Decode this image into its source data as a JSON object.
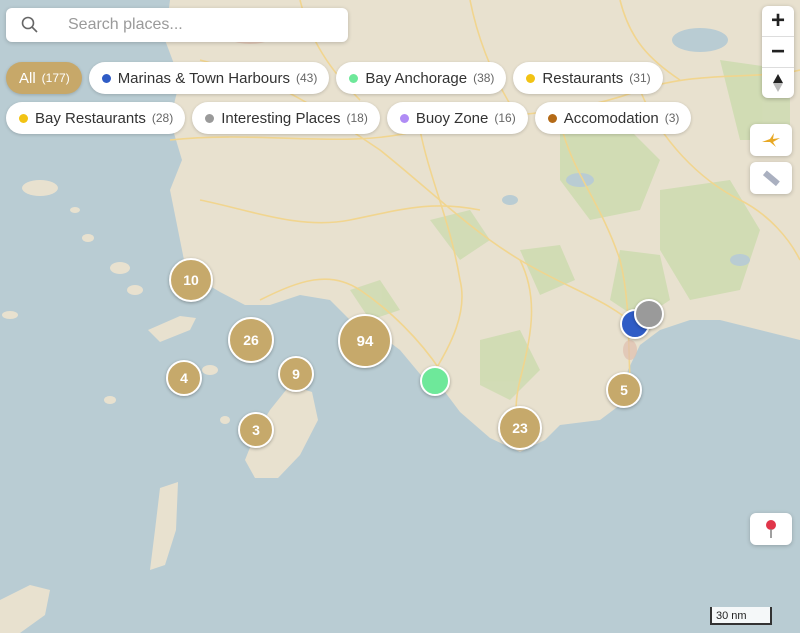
{
  "search": {
    "placeholder": "Search places..."
  },
  "filters": [
    {
      "label": "All",
      "count": "(177)",
      "color": "",
      "active": true
    },
    {
      "label": "Marinas & Town Harbours",
      "count": "(43)",
      "color": "#2f5cc6"
    },
    {
      "label": "Bay Anchorage",
      "count": "(38)",
      "color": "#6ee89a"
    },
    {
      "label": "Restaurants",
      "count": "(31)",
      "color": "#f2c314"
    },
    {
      "label": "Bay Restaurants",
      "count": "(28)",
      "color": "#f2c314"
    },
    {
      "label": "Interesting Places",
      "count": "(18)",
      "color": "#9a9a9a"
    },
    {
      "label": "Buoy Zone",
      "count": "(16)",
      "color": "#b08cf5"
    },
    {
      "label": "Accomodation",
      "count": "(3)",
      "color": "#b46a17"
    }
  ],
  "zoom": {
    "in": "+",
    "out": "−",
    "compass": "north-arrow-icon"
  },
  "clusters": [
    "10",
    "26",
    "94",
    "4",
    "9",
    "3",
    "23",
    "5"
  ],
  "markers": [
    {
      "type": "bay-anchorage",
      "color": "#6ee89a"
    },
    {
      "type": "marina",
      "color": "#2f5cc6"
    },
    {
      "type": "interesting-place",
      "color": "#9a9a9a"
    }
  ],
  "scale": {
    "label": "30 nm"
  },
  "colors": {
    "cluster": "#c6a96b",
    "water": "#b9ccd3",
    "land": "#e9e3d2"
  }
}
